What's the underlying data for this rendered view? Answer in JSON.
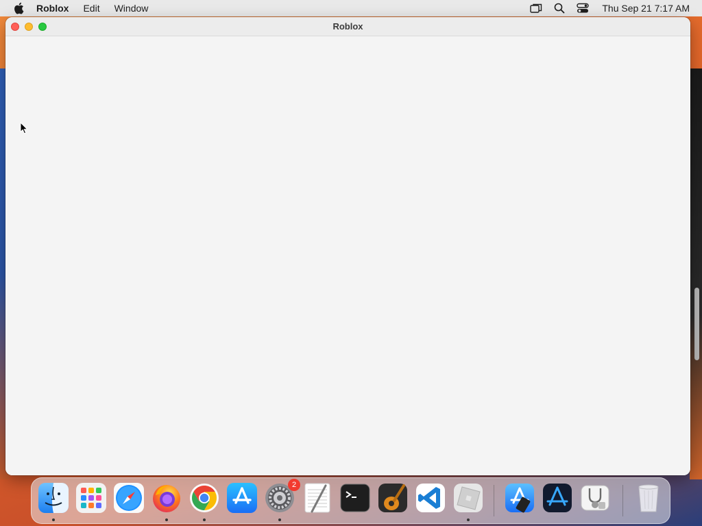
{
  "menubar": {
    "app_name": "Roblox",
    "items": [
      "Edit",
      "Window"
    ],
    "clock": "Thu Sep 21  7:17 AM"
  },
  "window": {
    "title": "Roblox"
  },
  "dock": {
    "items": [
      {
        "name": "Finder",
        "icon": "finder-icon",
        "running": true
      },
      {
        "name": "Launchpad",
        "icon": "launchpad-icon",
        "running": false
      },
      {
        "name": "Safari",
        "icon": "safari-icon",
        "running": false
      },
      {
        "name": "Firefox",
        "icon": "firefox-icon",
        "running": true
      },
      {
        "name": "Google Chrome",
        "icon": "chrome-icon",
        "running": true
      },
      {
        "name": "App Store",
        "icon": "app-store-icon",
        "running": false
      },
      {
        "name": "System Preferences",
        "icon": "system-preferences-icon",
        "running": true,
        "badge": "2"
      },
      {
        "name": "TextEdit",
        "icon": "textedit-icon",
        "running": false
      },
      {
        "name": "Terminal",
        "icon": "terminal-icon",
        "running": false
      },
      {
        "name": "GarageBand",
        "icon": "garageband-icon",
        "running": false
      },
      {
        "name": "Visual Studio Code",
        "icon": "vscode-icon",
        "running": false
      },
      {
        "name": "Roblox",
        "icon": "roblox-icon",
        "running": true
      },
      {
        "name": "Xcode Installer",
        "icon": "xcode-installer-icon",
        "running": false
      },
      {
        "name": "Instruments",
        "icon": "instruments-icon",
        "running": false
      },
      {
        "name": "Disk Utility",
        "icon": "disk-utility-icon",
        "running": false
      },
      {
        "name": "Trash",
        "icon": "trash-icon",
        "running": false
      }
    ]
  }
}
